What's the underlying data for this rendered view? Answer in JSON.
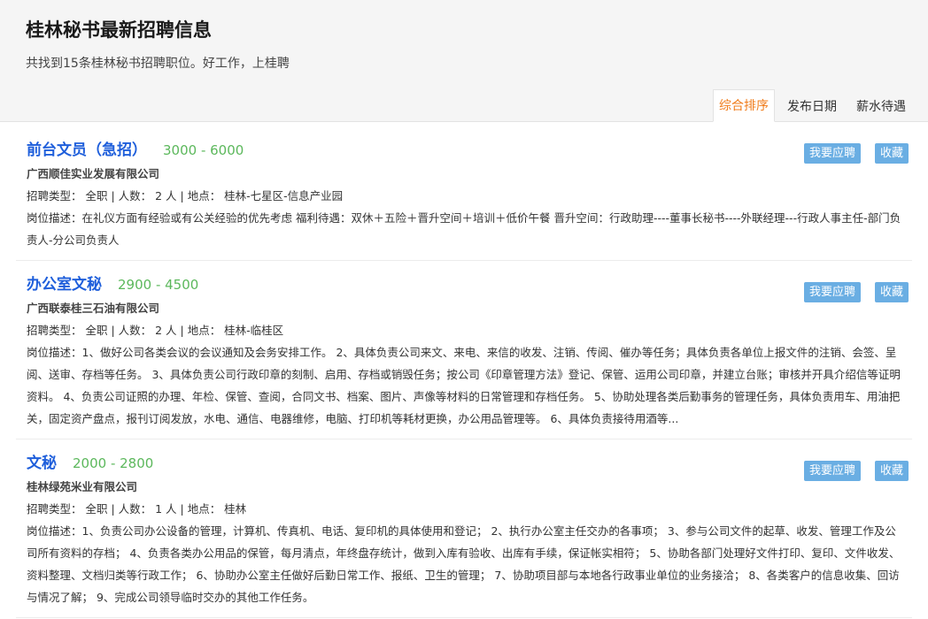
{
  "header": {
    "title": "桂林秘书最新招聘信息",
    "subtitle": "共找到15条桂林秘书招聘职位。好工作，上桂聘"
  },
  "sort_tabs": [
    {
      "label": "综合排序",
      "active": true
    },
    {
      "label": "发布日期",
      "active": false
    },
    {
      "label": "薪水待遇",
      "active": false
    }
  ],
  "actions": {
    "apply_label": "我要应聘",
    "favorite_label": "收藏"
  },
  "jobs": [
    {
      "title": "前台文员（急招）",
      "salary": "3000 - 6000",
      "company": "广西顺佳实业发展有限公司",
      "meta": "招聘类型：  全职 | 人数：  2 人 | 地点：  桂林-七星区-信息产业园",
      "desc_label": "岗位描述：",
      "desc": "在礼仪方面有经验或有公关经验的优先考虑 福利待遇：双休＋五险＋晋升空间＋培训＋低价午餐 晋升空间：行政助理----董事长秘书----外联经理---行政人事主任-部门负责人-分公司负责人"
    },
    {
      "title": "办公室文秘",
      "salary": "2900 - 4500",
      "company": "广西联泰桂三石油有限公司",
      "meta": "招聘类型：  全职 | 人数：  2 人 | 地点：  桂林-临桂区",
      "desc_label": "岗位描述：",
      "desc": "1、做好公司各类会议的会议通知及会务安排工作。 2、具体负责公司来文、来电、来信的收发、注销、传阅、催办等任务；具体负责各单位上报文件的注销、会签、呈阅、送审、存档等任务。 3、具体负责公司行政印章的刻制、启用、存档或销毁任务；按公司《印章管理方法》登记、保管、运用公司印章，并建立台账；审核并开具介绍信等证明资料。 4、负责公司证照的办理、年检、保管、查阅，合同文书、档案、图片、声像等材料的日常管理和存档任务。 5、协助处理各类后勤事务的管理任务，具体负责用车、用油把关，固定资产盘点，报刊订阅发放，水电、通信、电器维修，电脑、打印机等耗材更换，办公用品管理等。 6、具体负责接待用酒等..."
    },
    {
      "title": "文秘",
      "salary": "2000 - 2800",
      "company": "桂林绿苑米业有限公司",
      "meta": "招聘类型：  全职 | 人数：  1 人 | 地点：  桂林",
      "desc_label": "岗位描述：",
      "desc": "1、负责公司办公设备的管理，计算机、传真机、电话、复印机的具体使用和登记； 2、执行办公室主任交办的各事项； 3、参与公司文件的起草、收发、管理工作及公司所有资料的存档； 4、负责各类办公用品的保管，每月清点，年终盘存统计，做到入库有验收、出库有手续，保证帐实相符； 5、协助各部门处理好文件打印、复印、文件收发、资料整理、文档归类等行政工作； 6、协助办公室主任做好后勤日常工作、报纸、卫生的管理； 7、协助项目部与本地各行政事业单位的业务接洽； 8、各类客户的信息收集、回访与情况了解； 9、完成公司领导临时交办的其他工作任务。"
    }
  ]
}
